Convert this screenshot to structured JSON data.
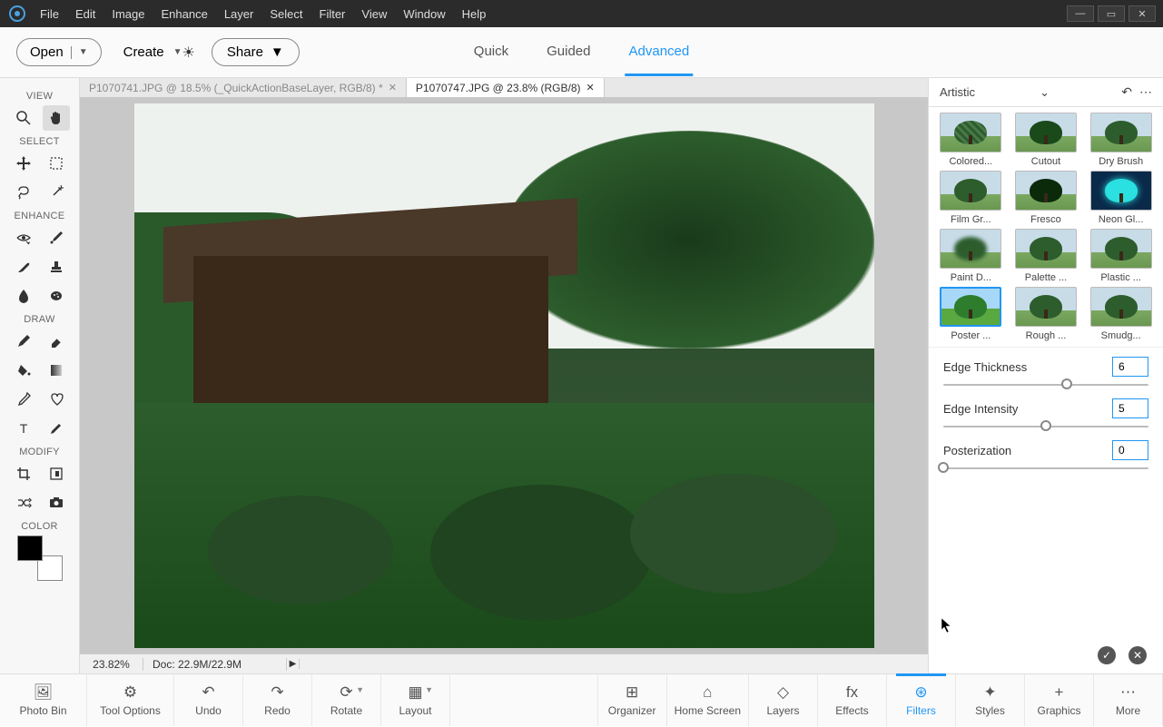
{
  "menubar": {
    "items": [
      "File",
      "Edit",
      "Image",
      "Enhance",
      "Layer",
      "Select",
      "Filter",
      "View",
      "Window",
      "Help"
    ]
  },
  "topbar": {
    "open_label": "Open",
    "create_label": "Create",
    "modes": [
      "Quick",
      "Guided",
      "Advanced"
    ],
    "active_mode": 2,
    "share_label": "Share"
  },
  "doc_tabs": [
    {
      "label": "P1070741.JPG @ 18.5% (_QuickActionBaseLayer, RGB/8) *",
      "active": false
    },
    {
      "label": "P1070747.JPG @ 23.8% (RGB/8)",
      "active": true
    }
  ],
  "left_toolbar": {
    "sections": [
      {
        "label": "VIEW",
        "tools": [
          [
            "zoom-icon",
            "hand-icon"
          ]
        ]
      },
      {
        "label": "SELECT",
        "tools": [
          [
            "move-icon",
            "marquee-icon"
          ],
          [
            "lasso-icon",
            "wand-icon"
          ]
        ]
      },
      {
        "label": "ENHANCE",
        "tools": [
          [
            "eye-icon",
            "eyedropper-fix-icon"
          ],
          [
            "brush-heal-icon",
            "stamp-icon"
          ],
          [
            "blur-icon",
            "sponge-icon"
          ]
        ]
      },
      {
        "label": "DRAW",
        "tools": [
          [
            "brush-icon",
            "eraser-icon"
          ],
          [
            "bucket-icon",
            "gradient-icon"
          ],
          [
            "dropper-icon",
            "shape-icon"
          ],
          [
            "type-icon",
            "pencil-icon"
          ]
        ]
      },
      {
        "label": "MODIFY",
        "tools": [
          [
            "crop-icon",
            "recompose-icon"
          ],
          [
            "shuffle-icon",
            "camera-icon"
          ]
        ]
      },
      {
        "label": "COLOR",
        "tools": []
      }
    ]
  },
  "right_panel": {
    "category": "Artistic",
    "filters": [
      {
        "name": "Colored...",
        "variant": "colored"
      },
      {
        "name": "Cutout",
        "variant": "cutout"
      },
      {
        "name": "Dry Brush",
        "variant": ""
      },
      {
        "name": "Film Gr...",
        "variant": ""
      },
      {
        "name": "Fresco",
        "variant": "fresco"
      },
      {
        "name": "Neon Gl...",
        "variant": "neon"
      },
      {
        "name": "Paint D...",
        "variant": "paintd"
      },
      {
        "name": "Palette ...",
        "variant": ""
      },
      {
        "name": "Plastic ...",
        "variant": ""
      },
      {
        "name": "Poster ...",
        "variant": "poster",
        "selected": true
      },
      {
        "name": "Rough ...",
        "variant": ""
      },
      {
        "name": "Smudg...",
        "variant": ""
      }
    ],
    "controls": [
      {
        "label": "Edge Thickness",
        "value": "6",
        "pos": 60
      },
      {
        "label": "Edge Intensity",
        "value": "5",
        "pos": 50
      },
      {
        "label": "Posterization",
        "value": "0",
        "pos": 0
      }
    ]
  },
  "status": {
    "zoom": "23.82%",
    "doc": "Doc: 22.9M/22.9M"
  },
  "bottom_bar": {
    "items": [
      {
        "label": "Photo Bin",
        "icon": "image-icon",
        "wide": true
      },
      {
        "label": "Tool Options",
        "icon": "sliders-icon",
        "wide": true
      },
      {
        "label": "Undo",
        "icon": "undo-icon"
      },
      {
        "label": "Redo",
        "icon": "redo-icon"
      },
      {
        "label": "Rotate",
        "icon": "rotate-icon",
        "dd": true
      },
      {
        "label": "Layout",
        "icon": "layout-icon",
        "dd": true
      }
    ],
    "items_right": [
      {
        "label": "Organizer",
        "icon": "organizer-icon"
      },
      {
        "label": "Home Screen",
        "icon": "home-icon"
      },
      {
        "label": "Layers",
        "icon": "layers-icon"
      },
      {
        "label": "Effects",
        "icon": "effects-icon"
      },
      {
        "label": "Filters",
        "icon": "filters-icon",
        "active": true
      },
      {
        "label": "Styles",
        "icon": "styles-icon"
      },
      {
        "label": "Graphics",
        "icon": "graphics-icon"
      },
      {
        "label": "More",
        "icon": "more-icon"
      }
    ]
  }
}
